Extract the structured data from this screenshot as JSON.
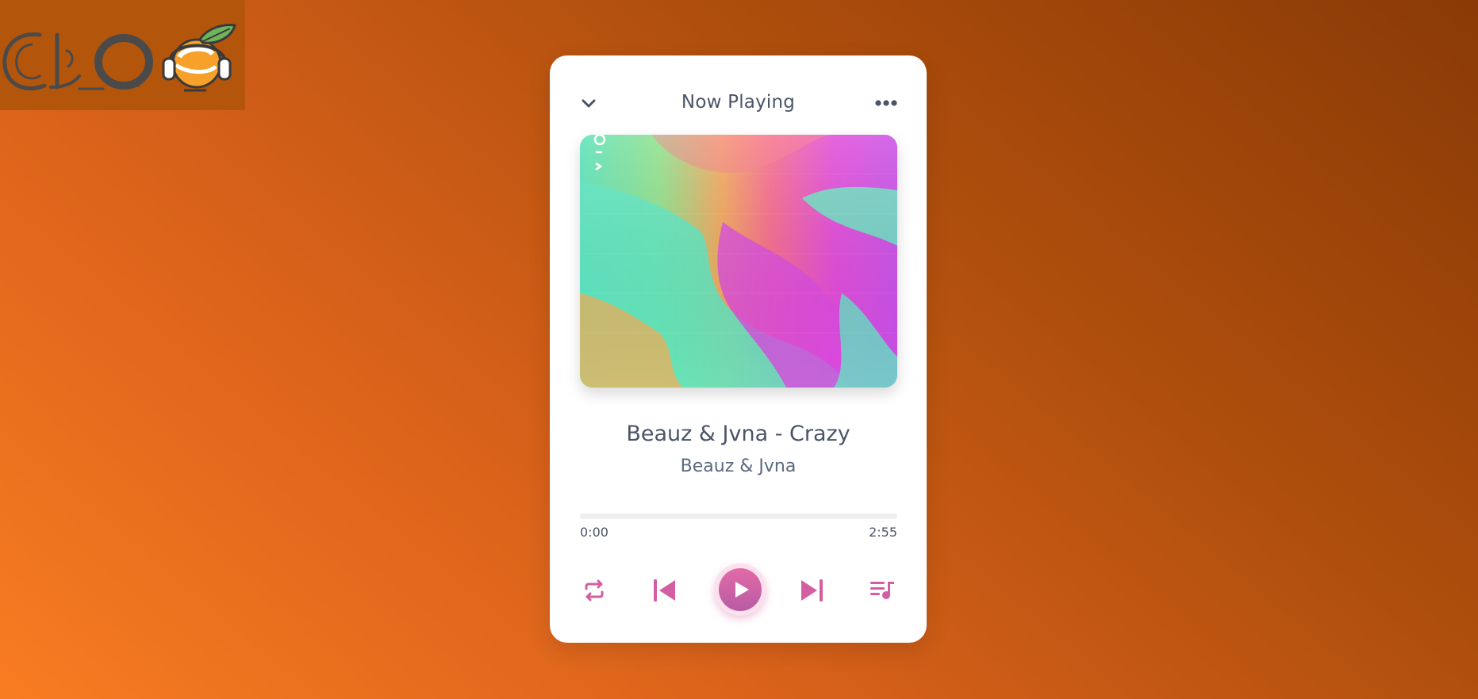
{
  "header": {
    "title": "Now Playing"
  },
  "track": {
    "title": "Beauz & Jvna - Crazy",
    "artist": "Beauz & Jvna"
  },
  "progress": {
    "current": "0:00",
    "duration": "2:55",
    "fraction": 0
  },
  "logo": {
    "text": "CLO"
  },
  "icons": {
    "back": "chevron-down-icon",
    "more": "more-horizontal-icon",
    "repeat": "repeat-icon",
    "previous": "skip-previous-icon",
    "play": "play-icon",
    "next": "skip-next-icon",
    "queue": "queue-music-icon"
  },
  "colors": {
    "accent": "#d35fa2",
    "text": "#4a5568",
    "background_start": "#f97c22",
    "background_end": "#8a3a06"
  }
}
